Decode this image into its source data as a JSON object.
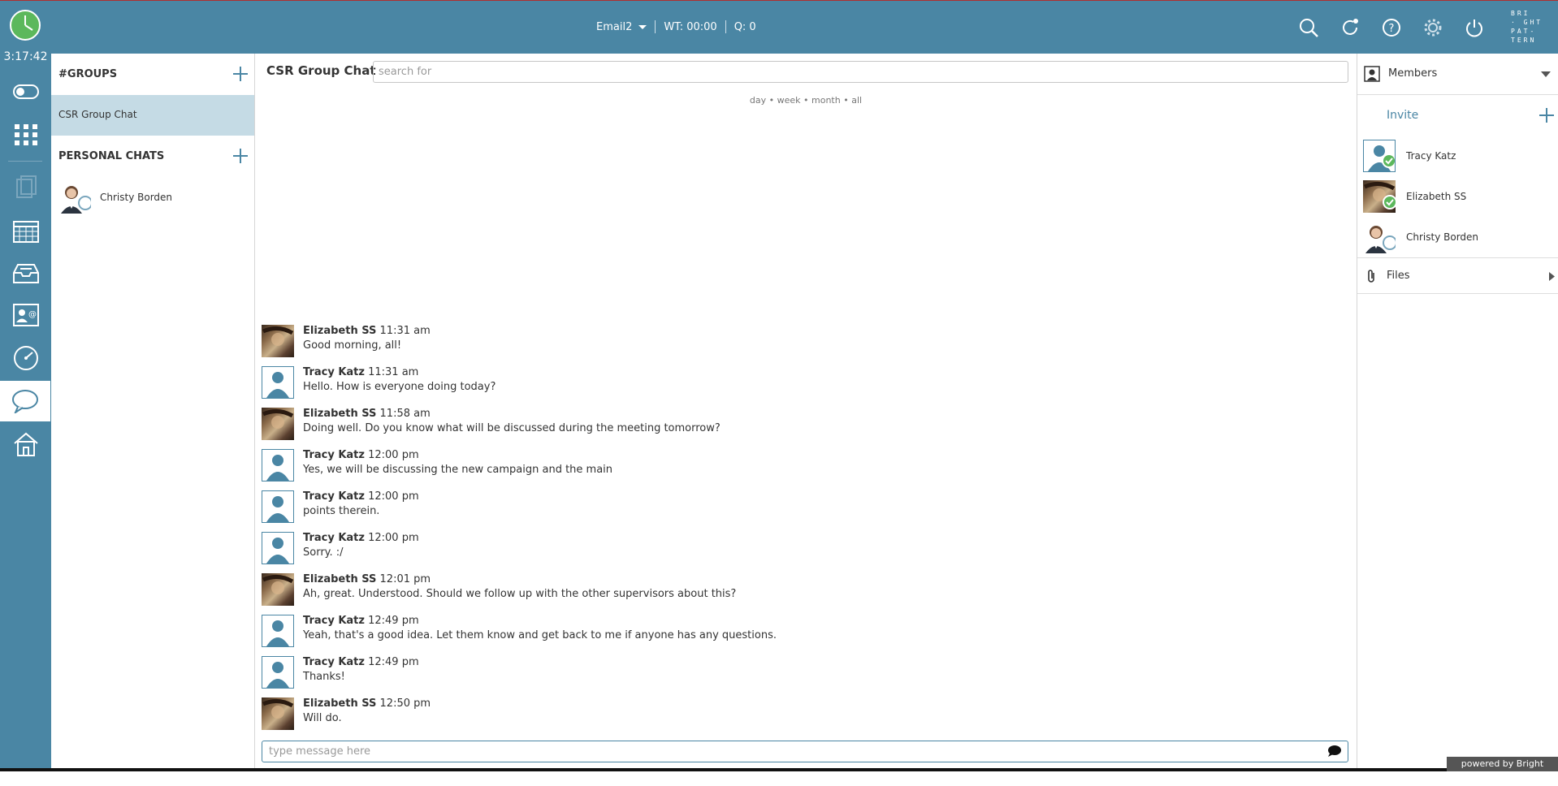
{
  "topbar": {
    "status_name": "Email2",
    "wait_time": "WT: 00:00",
    "queue": "Q: 0",
    "logo_lines": [
      "BRI",
      "· GHT",
      "PAT-",
      "TERN"
    ]
  },
  "leftnav": {
    "time": "3:17:42",
    "items": [
      "toggle-icon",
      "dialpad-icon",
      "document-icon",
      "calendar-icon",
      "inbox-icon",
      "contact-card-icon",
      "dashboard-icon",
      "chat-icon",
      "home-icon"
    ],
    "active": "chat-icon"
  },
  "groups": {
    "groups_header": "#GROUPS",
    "group_items": [
      "CSR Group Chat"
    ],
    "personal_header": "PERSONAL CHATS",
    "personal_items": [
      "Christy Borden"
    ]
  },
  "chat": {
    "title": "CSR Group Chat",
    "search_placeholder": "search for",
    "filters": "day • week • month • all",
    "compose_placeholder": "type message here",
    "messages": [
      {
        "author": "Elizabeth SS",
        "time": "11:31 am",
        "text": "Good morning, all!"
      },
      {
        "author": "Tracy Katz",
        "time": "11:31 am",
        "text": "Hello. How is everyone doing today?"
      },
      {
        "author": "Elizabeth SS",
        "time": "11:58 am",
        "text": "Doing well. Do you know what will be discussed during the meeting tomorrow?"
      },
      {
        "author": "Tracy Katz",
        "time": "12:00 pm",
        "text": "Yes, we will be discussing the new campaign and the main"
      },
      {
        "author": "Tracy Katz",
        "time": "12:00 pm",
        "text": "points therein."
      },
      {
        "author": "Tracy Katz",
        "time": "12:00 pm",
        "text": "Sorry. :/"
      },
      {
        "author": "Elizabeth SS",
        "time": "12:01 pm",
        "text": "Ah, great. Understood. Should we follow up with the other supervisors about this?"
      },
      {
        "author": "Tracy Katz",
        "time": "12:49 pm",
        "text": "Yeah, that's a good idea. Let them know and get back to me if anyone has any questions."
      },
      {
        "author": "Tracy Katz",
        "time": "12:49 pm",
        "text": "Thanks!"
      },
      {
        "author": "Elizabeth SS",
        "time": "12:50 pm",
        "text": "Will do."
      }
    ]
  },
  "members": {
    "header": "Members",
    "invite": "Invite",
    "list": [
      {
        "name": "Tracy Katz",
        "status": "online"
      },
      {
        "name": "Elizabeth SS",
        "status": "online"
      },
      {
        "name": "Christy Borden",
        "status": "offline"
      }
    ],
    "files": "Files"
  },
  "footer": {
    "powered": "powered by Bright Pattern"
  },
  "colors": {
    "brand": "#4a86a4",
    "selected": "#c5dbe5",
    "online": "#5cb85c"
  }
}
